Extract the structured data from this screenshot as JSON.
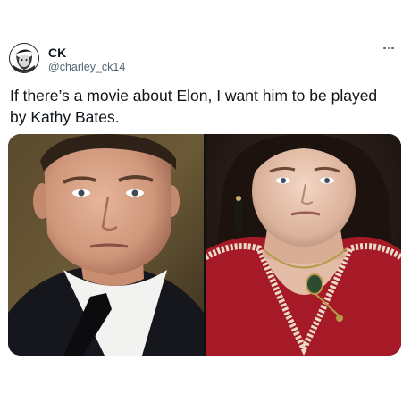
{
  "author": {
    "display_name": "CK",
    "handle": "@charley_ck14",
    "avatar_icon": "profile-avatar"
  },
  "more_icon": "ellipsis-icon",
  "tweet": {
    "text": "If there’s a movie about Elon, I want him to be played\nby Kathy Bates."
  },
  "media": {
    "photos": [
      {
        "subject": "man-in-suit-portrait"
      },
      {
        "subject": "woman-in-red-dress-portrait"
      }
    ]
  },
  "colors": {
    "text": "#0f1419",
    "secondary_text": "#536471",
    "background": "#ffffff"
  }
}
